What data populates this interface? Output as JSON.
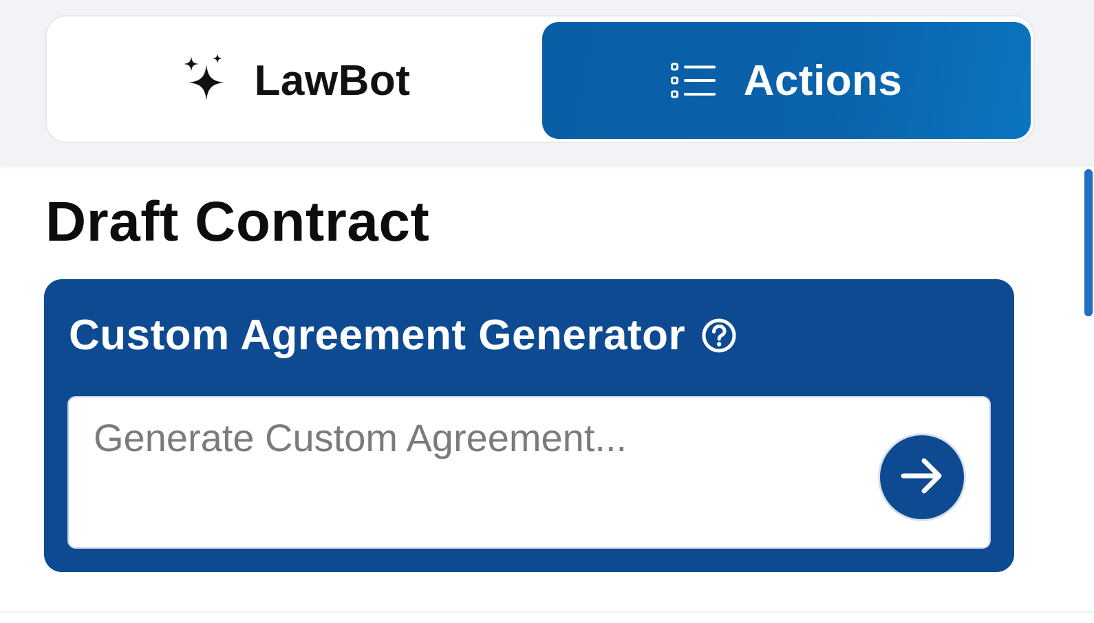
{
  "tabs": {
    "lawbot": {
      "label": "LawBot",
      "icon": "sparkles-icon",
      "active": false
    },
    "actions": {
      "label": "Actions",
      "icon": "list-icon",
      "active": true
    }
  },
  "page_title": "Draft Contract",
  "card": {
    "title": "Custom Agreement Generator",
    "help_icon": "question-circle-icon",
    "input": {
      "value": "",
      "placeholder": "Generate Custom Agreement..."
    },
    "submit_icon": "arrow-right-icon"
  },
  "colors": {
    "active_tab": "#0a5ea6",
    "card_background": "#0d4a91",
    "scrollbar_thumb": "#1f6fc4",
    "topbar_background": "#f1f3f6"
  }
}
